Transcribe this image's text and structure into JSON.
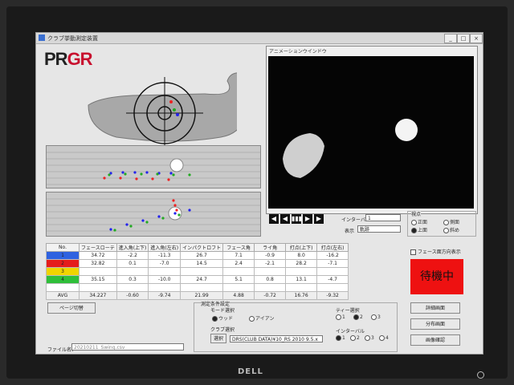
{
  "window": {
    "title": "クラブ挙動測定装置",
    "minimize_glyph": "_",
    "maximize_glyph": "□",
    "close_glyph": "×"
  },
  "brand": {
    "part1": "PR",
    "part2": "GR"
  },
  "animation": {
    "title": "アニメーションウインドウ",
    "interval_label": "インターバル",
    "interval_value": "1",
    "display_label": "表示",
    "display_value": "軌跡"
  },
  "playback": {
    "rewind": "◀",
    "step_back": "◀",
    "frames": "▮▮▮",
    "step_forward": "▶",
    "fast_forward": "▶"
  },
  "viewpoint": {
    "label": "視点",
    "options": [
      "正面",
      "側面",
      "上面",
      "斜め"
    ],
    "selected": "上面"
  },
  "table": {
    "headers": [
      "No.",
      "フェースローテ",
      "進入角(上下)",
      "進入角(左右)",
      "インパクトロフト",
      "フェース角",
      "ライ角",
      "打点(上下)",
      "打点(左右)"
    ],
    "rows": [
      [
        "1",
        "34.72",
        "-2.2",
        "-11.3",
        "26.7",
        "7.1",
        "-0.9",
        "8.0",
        "-16.2"
      ],
      [
        "2",
        "32.82",
        "0.1",
        "-7.0",
        "14.5",
        "2.4",
        "-2.1",
        "28.2",
        "-7.1"
      ],
      [
        "3",
        "",
        "",
        "",
        "",
        "",
        "",
        "",
        ""
      ],
      [
        "4",
        "35.15",
        "0.3",
        "-10.0",
        "24.7",
        "5.1",
        "0.8",
        "13.1",
        "-4.7"
      ]
    ],
    "row_colors": [
      "#2f62e0",
      "#e51c1c",
      "#f0d400",
      "#2fbf3a"
    ],
    "avg": [
      "AVG",
      "34.227",
      "-0.60",
      "-9.74",
      "21.99",
      "4.88",
      "-0.72",
      "16.76",
      "-9.32"
    ]
  },
  "face_direction_label": "フェース面方向表示",
  "status": "待機中",
  "status_color": "#ee1111",
  "buttons": {
    "page_switch": "ページ切替",
    "detail": "詳細画面",
    "distribution": "分布画面",
    "image_check": "画像確認"
  },
  "file": {
    "label": "ファイル名：",
    "value": "20210211_Swing.csv"
  },
  "settings": {
    "title": "測定条件設定",
    "mode_label": "モード選択",
    "mode_options": [
      "ウッド",
      "アイアン"
    ],
    "mode_selected": "ウッド",
    "club_label": "クラブ選択",
    "club_button": "選択",
    "club_value": "DRS(CLUB DATA)¥10_RS 2010 9.5.x",
    "tee_label": "ティー選択",
    "tee_options": [
      "1",
      "2",
      "3"
    ],
    "tee_selected": "2",
    "interval_label": "インターバル",
    "interval_options": [
      "1",
      "2",
      "3",
      "4"
    ],
    "interval_selected": "1"
  }
}
